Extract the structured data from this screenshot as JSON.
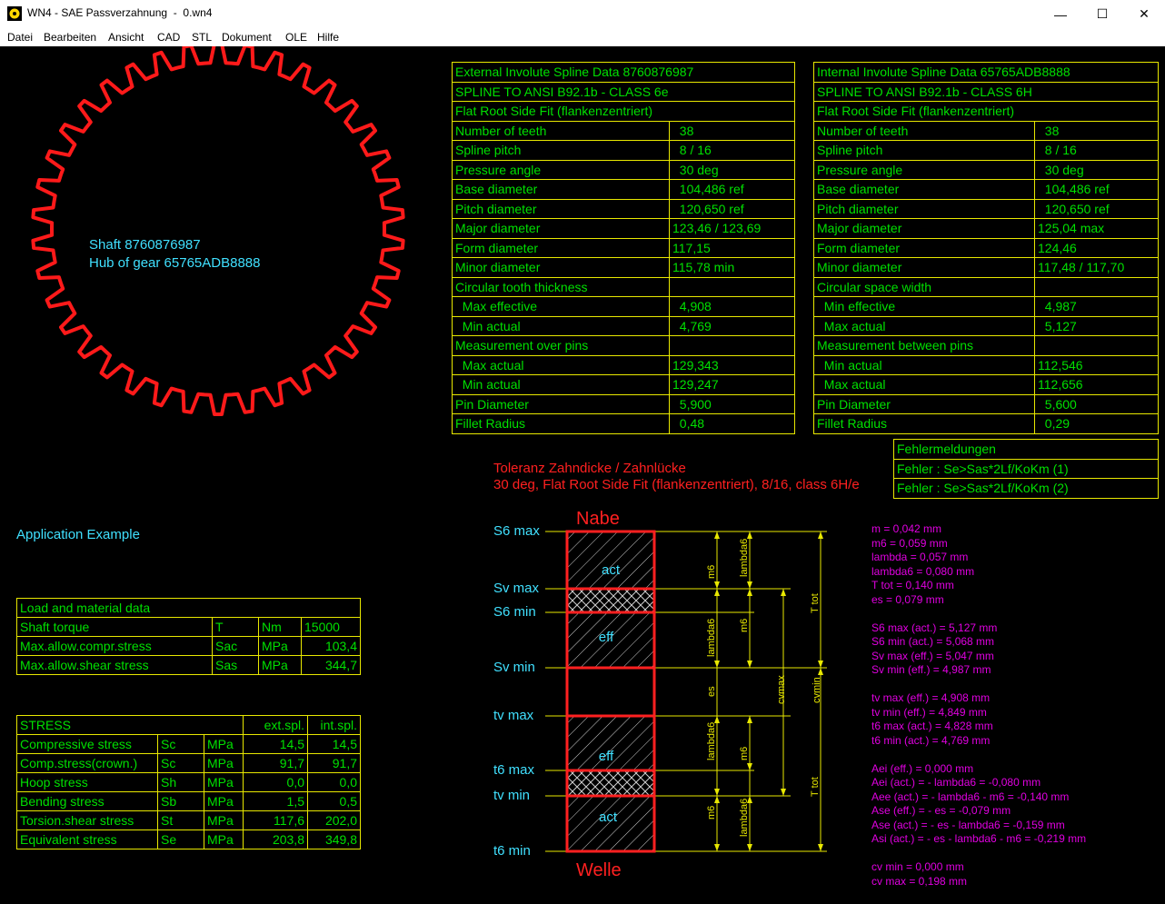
{
  "window": {
    "title": "WN4 - SAE Passverzahnung  -  0.wn4",
    "minimize": "—",
    "maximize": "☐",
    "close": "✕"
  },
  "menu": [
    "Datei",
    "Bearbeiten",
    "Ansicht",
    "CAD",
    "STL",
    "Dokument",
    "OLE",
    "Hilfe"
  ],
  "gear": {
    "teeth": 38,
    "color": "#ff1a1a",
    "shaft_label": "Shaft 8760876987",
    "hub_label": "Hub of gear 65765ADB8888"
  },
  "application_example": "Application Example",
  "external": {
    "header": "External Involute Spline Data   8760876987",
    "standard": "SPLINE TO ANSI B92.1b - CLASS 6e",
    "fit": "Flat Root Side Fit (flankenzentriert)",
    "rows": [
      [
        "Number of teeth",
        "  38"
      ],
      [
        "Spline pitch",
        "  8 / 16"
      ],
      [
        "Pressure angle",
        "  30 deg"
      ],
      [
        "Base diameter",
        "  104,486 ref"
      ],
      [
        "Pitch diameter",
        "  120,650 ref"
      ],
      [
        "Major diameter",
        "123,46 / 123,69"
      ],
      [
        "Form diameter",
        "117,15"
      ],
      [
        "Minor diameter",
        "115,78 min"
      ],
      [
        "Circular tooth thickness",
        ""
      ],
      [
        "  Max effective",
        "  4,908"
      ],
      [
        "  Min actual",
        "  4,769"
      ],
      [
        "Measurement over pins",
        ""
      ],
      [
        "  Max actual",
        "129,343"
      ],
      [
        "  Min actual",
        "129,247"
      ],
      [
        "Pin Diameter",
        "  5,900"
      ],
      [
        "Fillet Radius",
        "  0,48"
      ]
    ]
  },
  "internal": {
    "header": "Internal Involute Spline Data   65765ADB8888",
    "standard": "SPLINE TO ANSI B92.1b - CLASS 6H",
    "fit": "Flat Root Side Fit (flankenzentriert)",
    "rows": [
      [
        "Number of teeth",
        "  38"
      ],
      [
        "Spline pitch",
        "  8 / 16"
      ],
      [
        "Pressure angle",
        "  30 deg"
      ],
      [
        "Base diameter",
        "  104,486 ref"
      ],
      [
        "Pitch diameter",
        "  120,650 ref"
      ],
      [
        "Major diameter",
        "125,04 max"
      ],
      [
        "Form diameter",
        "124,46"
      ],
      [
        "Minor diameter",
        "117,48 / 117,70"
      ],
      [
        "Circular space width",
        ""
      ],
      [
        "  Min effective",
        "  4,987"
      ],
      [
        "  Max actual",
        "  5,127"
      ],
      [
        "Measurement between pins",
        ""
      ],
      [
        "  Min actual",
        "112,546"
      ],
      [
        "  Max actual",
        "112,656"
      ],
      [
        "Pin Diameter",
        "  5,600"
      ],
      [
        "Fillet Radius",
        "  0,29"
      ]
    ]
  },
  "errors": {
    "header": "Fehlermeldungen",
    "items": [
      "Fehler : Se>Sas*2Lf/KoKm (1)",
      "Fehler : Se>Sas*2Lf/KoKm (2)"
    ]
  },
  "tolerance": {
    "title": "Toleranz Zahndicke / Zahnlücke",
    "subtitle": "30 deg, Flat Root Side Fit (flankenzentriert), 8/16, class 6H/e",
    "nabe": "Nabe",
    "welle": "Welle",
    "left_labels": [
      "S6 max",
      "Sv max",
      "S6 min",
      "Sv min",
      "tv max",
      "t6 max",
      "tv min",
      "t6 min"
    ],
    "box_labels": [
      "act",
      "eff",
      "eff",
      "act"
    ],
    "dim_labels": {
      "m6": "m6",
      "lambda6": "lambda6",
      "es": "es",
      "cvmax": "cvmax",
      "cvmin": "cvmin",
      "ttot": "T tot"
    }
  },
  "results": [
    "m = 0,042 mm",
    "m6 = 0,059 mm",
    "lambda = 0,057 mm",
    "lambda6 = 0,080 mm",
    "T tot = 0,140 mm",
    "es = 0,079 mm",
    "",
    "S6 max (act.) = 5,127 mm",
    "S6 min (act.) = 5,068 mm",
    "Sv max (eff.) = 5,047 mm",
    "Sv min (eff.) = 4,987 mm",
    "",
    "tv max (eff.) = 4,908 mm",
    "tv min (eff.) = 4,849 mm",
    "t6 max (act.) = 4,828 mm",
    "t6 min (act.) = 4,769 mm",
    "",
    "Aei (eff.) = 0,000 mm",
    "Aei (act.) = - lambda6 = -0,080 mm",
    "Aee (act.) = - lambda6 - m6 = -0,140 mm",
    "Ase (eff.) = - es = -0,079 mm",
    "Ase (act.) = - es - lambda6 = -0,159 mm",
    "Asi (act.) = - es - lambda6 - m6 = -0,219 mm",
    "",
    "cv min = 0,000 mm",
    "cv max = 0,198 mm"
  ],
  "load": {
    "header": "Load and material data",
    "rows": [
      [
        "Shaft torque",
        "T",
        "Nm",
        "15000"
      ],
      [
        "Max.allow.compr.stress",
        "Sac",
        "MPa",
        "103,4"
      ],
      [
        "Max.allow.shear stress",
        "Sas",
        "MPa",
        "344,7"
      ]
    ]
  },
  "stress": {
    "header": "STRESS",
    "col_ext": "ext.spl.",
    "col_int": "int.spl.",
    "rows": [
      [
        "Compressive stress",
        "Sc",
        "MPa",
        "14,5",
        "14,5"
      ],
      [
        "Comp.stress(crown.)",
        "Sc",
        "MPa",
        "91,7",
        "91,7"
      ],
      [
        "Hoop stress",
        "Sh",
        "MPa",
        "0,0",
        "0,0"
      ],
      [
        "Bending stress",
        "Sb",
        "MPa",
        "1,5",
        "0,5"
      ],
      [
        "Torsion.shear stress",
        "St",
        "MPa",
        "117,6",
        "202,0"
      ],
      [
        "Equivalent stress",
        "Se",
        "MPa",
        "203,8",
        "349,8"
      ]
    ]
  }
}
